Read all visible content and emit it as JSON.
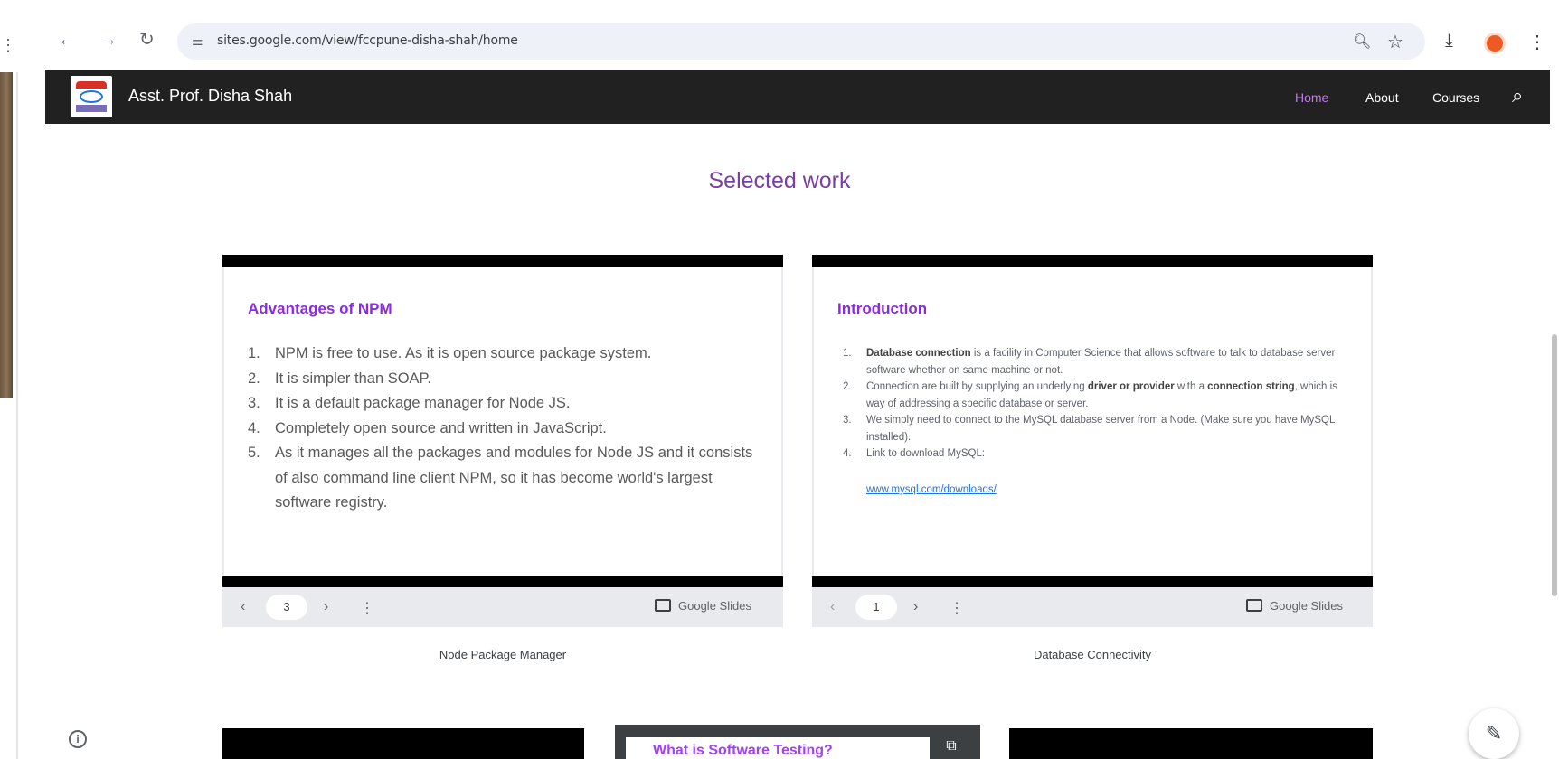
{
  "browser": {
    "url": "sites.google.com/view/fccpune-disha-shah/home",
    "icons": [
      "back-icon",
      "forward-icon",
      "reload-icon",
      "site-info-icon",
      "zoom-icon",
      "bookmark-star-icon",
      "download-icon",
      "menu-icon"
    ]
  },
  "site": {
    "title": "Asst. Prof. Disha Shah",
    "nav": [
      {
        "label": "Home",
        "active": true
      },
      {
        "label": "About",
        "active": false
      },
      {
        "label": "Courses",
        "active": false
      }
    ],
    "accent_color": "#c27de8"
  },
  "section": {
    "heading": "Selected work"
  },
  "slides": [
    {
      "heading": "Advantages of NPM",
      "items": [
        {
          "num": "1.",
          "text": "NPM is free to use. As it is open source package system."
        },
        {
          "num": "2.",
          "text": "It is simpler than SOAP."
        },
        {
          "num": "3.",
          "text": "It is a default package manager for Node JS."
        },
        {
          "num": "4.",
          "text": "Completely open source and written in JavaScript."
        },
        {
          "num": "5.",
          "text": "As it manages all the packages and modules for Node JS and it consists of also command line client NPM, so it has become world's largest software registry."
        }
      ],
      "page": "3",
      "badge": "Google Slides",
      "caption": "Node Package Manager"
    },
    {
      "heading": "Introduction",
      "items": [
        {
          "num": "1.",
          "bold": "Database connection",
          "text": " is a facility in Computer Science that allows software to talk to database server software whether on same machine or not."
        },
        {
          "num": "2.",
          "pre": "Connection are built by supplying an underlying ",
          "bold": "driver or provider",
          "mid": " with a ",
          "bold2": "connection string",
          "text": ", which is way of addressing a specific database or server."
        },
        {
          "num": "3.",
          "text": "We simply need to connect to the MySQL database server from a Node. (Make sure you have MySQL installed)."
        },
        {
          "num": "4.",
          "text": "Link to download MySQL:"
        }
      ],
      "link": "www.mysql.com/downloads/",
      "page": "1",
      "badge": "Google Slides",
      "caption": "Database Connectivity"
    }
  ],
  "bottom_preview": {
    "title": "What is Software Testing?"
  }
}
